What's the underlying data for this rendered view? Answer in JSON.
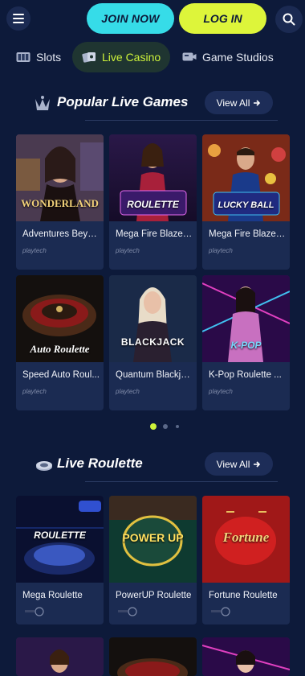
{
  "header": {
    "join_label": "JOIN NOW",
    "login_label": "LOG IN"
  },
  "categories": [
    {
      "label": "Slots",
      "icon": "slots-icon"
    },
    {
      "label": "Live Casino",
      "icon": "live-casino-icon",
      "active": true
    },
    {
      "label": "Game Studios",
      "icon": "game-studios-icon"
    }
  ],
  "colors": {
    "background": "#0d1a3a",
    "join": "#36dce8",
    "login": "#ddf53a",
    "active_tab_text": "#cdf23a",
    "card": "#1b2b52"
  },
  "popular": {
    "title": "Popular Live Games",
    "view_all": "View All",
    "games": [
      {
        "title": "Adventures Beyo...",
        "provider": "playtech",
        "art_text": "WONDERLAND"
      },
      {
        "title": "Mega Fire Blaze ...",
        "provider": "playtech",
        "art_text": "ROULETTE"
      },
      {
        "title": "Mega Fire Blaze ...",
        "provider": "playtech",
        "art_text": "LUCKY BALL"
      },
      {
        "title": "Speed Auto Roul...",
        "provider": "playtech",
        "art_text": "Auto Roulette"
      },
      {
        "title": "Quantum Blackja...",
        "provider": "playtech",
        "art_text": "BLACKJACK"
      },
      {
        "title": "K-Pop Roulette ...",
        "provider": "playtech",
        "art_text": "K-POP"
      }
    ]
  },
  "live_roulette": {
    "title": "Live Roulette",
    "view_all": "View All",
    "games": [
      {
        "title": "Mega Roulette",
        "art_text": "ROULETTE"
      },
      {
        "title": "PowerUP Roulette",
        "art_text": "POWER UP"
      },
      {
        "title": "Fortune Roulette",
        "art_text": "Fortune"
      }
    ]
  },
  "pagination": {
    "pages": 3,
    "current": 1
  }
}
